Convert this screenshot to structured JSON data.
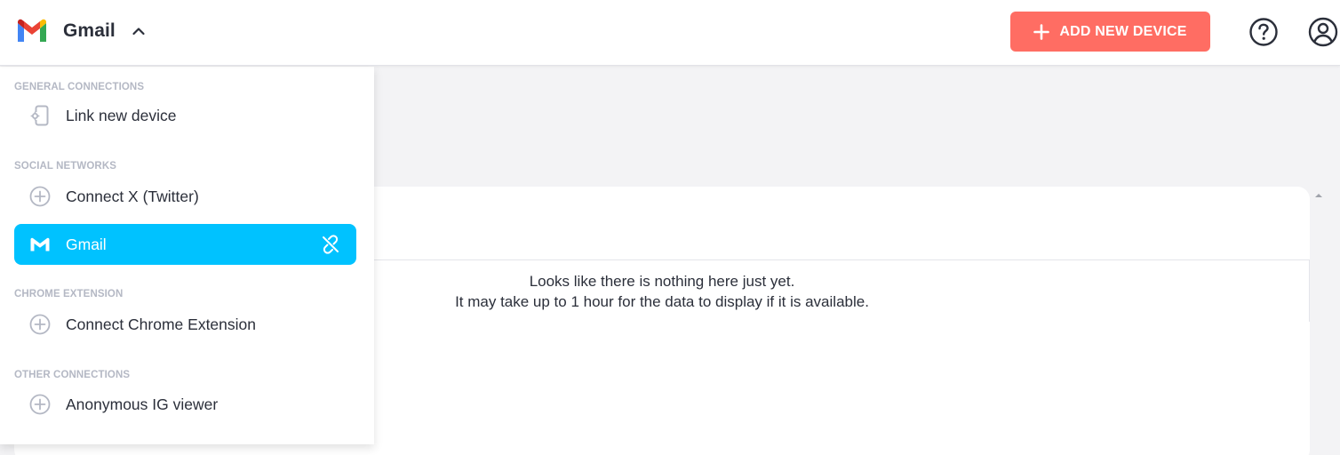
{
  "header": {
    "app_name": "Gmail",
    "add_button_label": "ADD NEW DEVICE",
    "logo_icon": "gmail-logo-icon",
    "chevron_icon": "chevron-up-icon",
    "help_icon": "help-circle-icon",
    "account_icon": "account-circle-icon"
  },
  "dropdown": {
    "sections": [
      {
        "title": "GENERAL CONNECTIONS",
        "items": [
          {
            "label": "Link new device",
            "icon": "phone-settings-icon"
          }
        ]
      },
      {
        "title": "SOCIAL NETWORKS",
        "items": [
          {
            "label": "Connect X (Twitter)",
            "icon": "plus-circle-icon"
          },
          {
            "label": "Gmail",
            "icon": "gmail-icon",
            "active": true,
            "action_icon": "unlink-icon"
          }
        ]
      },
      {
        "title": "CHROME EXTENSION",
        "items": [
          {
            "label": "Connect Chrome Extension",
            "icon": "plus-circle-icon"
          }
        ]
      },
      {
        "title": "OTHER CONNECTIONS",
        "items": [
          {
            "label": "Anonymous IG viewer",
            "icon": "plus-circle-icon"
          }
        ]
      }
    ]
  },
  "content": {
    "empty_line1": "Looks like there is nothing here just yet.",
    "empty_line2": "It may take up to 1 hour for the data to display if it is available."
  },
  "colors": {
    "accent_button": "#ff6d63",
    "active_item": "#00c2ff",
    "section_title": "#b4b8c4",
    "text": "#2b2f3a"
  }
}
